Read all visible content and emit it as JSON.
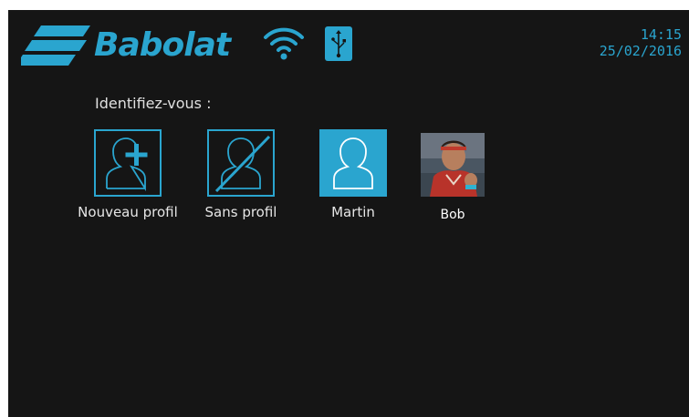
{
  "brand": {
    "name": "Babolat",
    "color": "#2aa5cf"
  },
  "status": {
    "wifi_icon": "wifi-icon",
    "usb_icon": "usb-icon",
    "time": "14:15",
    "date": "25/02/2016"
  },
  "prompt": "Identifiez-vous :",
  "profiles": [
    {
      "label": "Nouveau profil",
      "icon": "add-user-icon"
    },
    {
      "label": "Sans profil",
      "icon": "no-user-icon"
    },
    {
      "label": "Martin",
      "icon": "user-icon",
      "selected": true
    },
    {
      "label": "Bob",
      "icon": "photo"
    }
  ],
  "colors": {
    "background": "#151515",
    "accent": "#2aa5cf",
    "text": "#e0e0e0"
  }
}
